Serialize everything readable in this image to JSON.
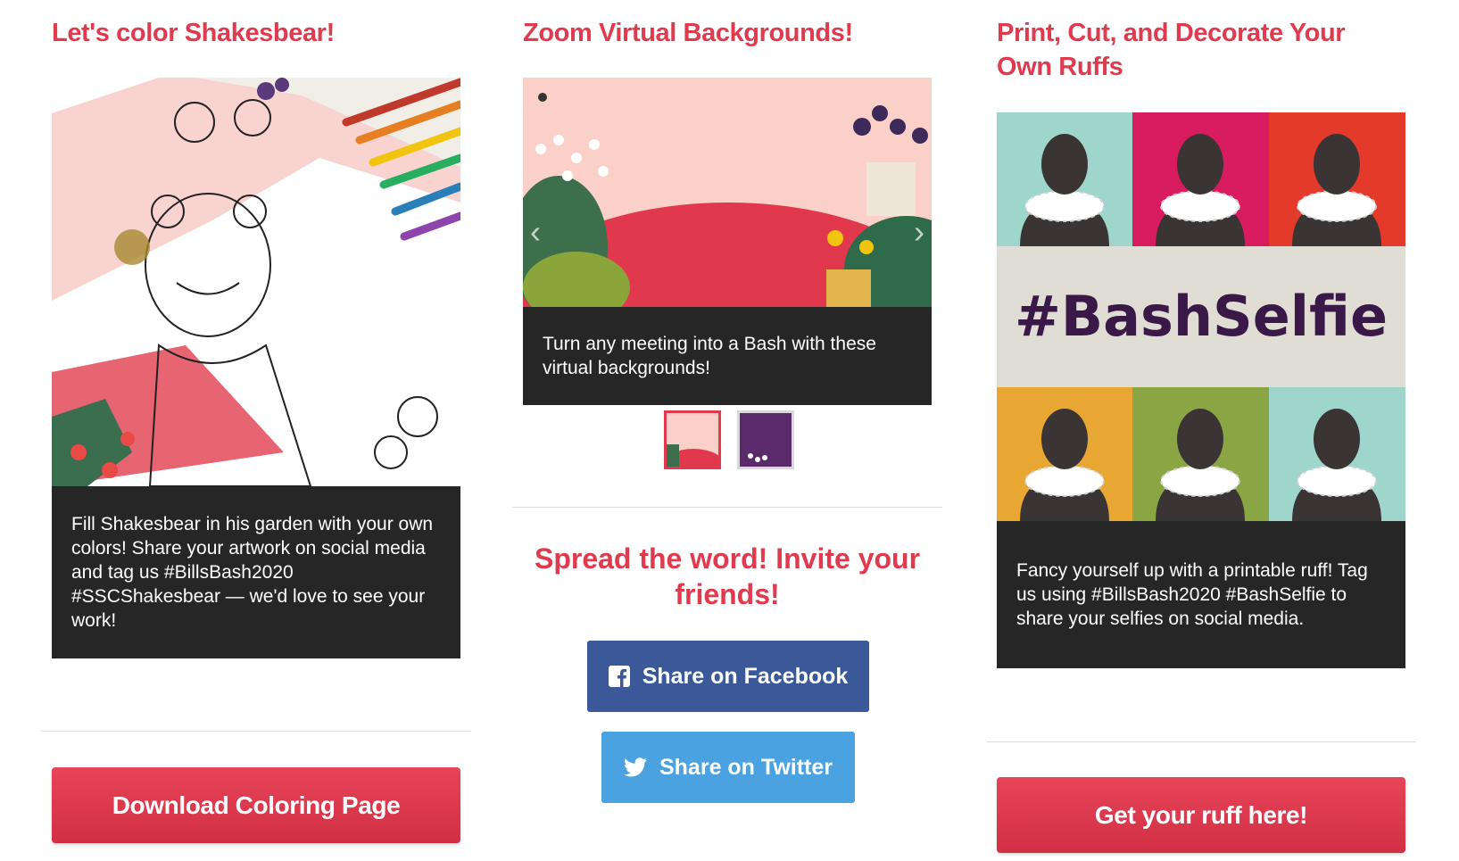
{
  "coloring": {
    "title": "Let's color Shakesbear!",
    "caption": "Fill Shakesbear in his garden with your own colors! Share your artwork on social media and tag us #BillsBash2020 #SSCShakesbear — we'd love to see your work!",
    "button_label": "Download Coloring Page"
  },
  "zoom": {
    "title": "Zoom Virtual Backgrounds!",
    "caption": "Turn any meeting into a Bash with these virtual backgrounds!",
    "prev_label": "‹",
    "next_label": "›",
    "thumbnails": [
      "thumbnail-1",
      "thumbnail-2"
    ]
  },
  "share": {
    "title": "Spread the word! Invite your friends!",
    "facebook_label": "Share on Facebook",
    "twitter_label": "Share on Twitter"
  },
  "ruff": {
    "title": "Print, Cut, and Decorate Your Own Ruffs",
    "hashtag": "#BashSelfie",
    "caption": "Fancy yourself up with a printable ruff! Tag us using #BillsBash2020 #BashSelfie to share your selfies on social media.",
    "button_label": "Get your ruff here!"
  },
  "colors": {
    "accent": "#e03a4e",
    "facebook": "#3b5998",
    "twitter": "#4aa3e0",
    "caption_bg": "#262626"
  },
  "icons": [
    "facebook-icon",
    "twitter-icon",
    "chevron-left-icon",
    "chevron-right-icon"
  ]
}
